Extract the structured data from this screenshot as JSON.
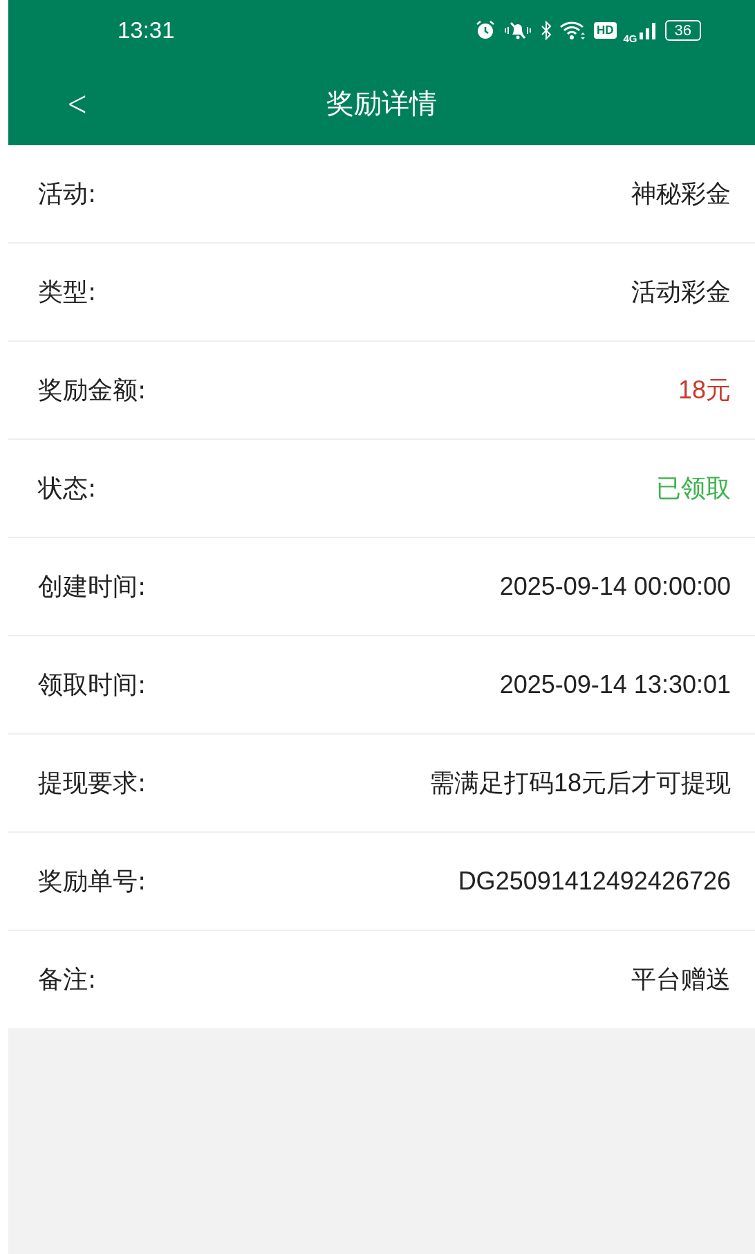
{
  "status_bar": {
    "time": "13:31",
    "network": "4G",
    "hd": "HD",
    "battery": "36"
  },
  "header": {
    "back": "<",
    "title": "奖励详情"
  },
  "rows": [
    {
      "label": "活动:",
      "value": "神秘彩金",
      "kind": "plain"
    },
    {
      "label": "类型:",
      "value": "活动彩金",
      "kind": "plain"
    },
    {
      "label": "奖励金额:",
      "value": "18元",
      "kind": "amount"
    },
    {
      "label": "状态:",
      "value": "已领取",
      "kind": "status"
    },
    {
      "label": "创建时间:",
      "value": "2025-09-14 00:00:00",
      "kind": "plain"
    },
    {
      "label": "领取时间:",
      "value": "2025-09-14 13:30:01",
      "kind": "plain"
    },
    {
      "label": "提现要求:",
      "value": "需满足打码18元后才可提现",
      "kind": "plain"
    },
    {
      "label": "奖励单号:",
      "value": "DG25091412492426726",
      "kind": "plain"
    },
    {
      "label": "备注:",
      "value": "平台赠送",
      "kind": "plain"
    }
  ]
}
